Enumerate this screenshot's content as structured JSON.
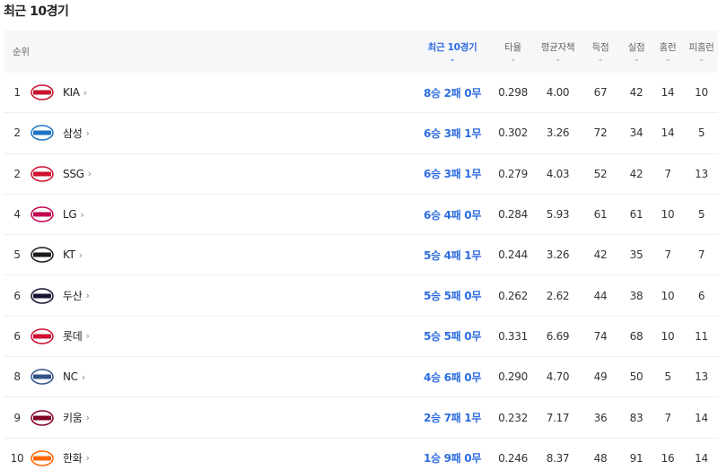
{
  "page": {
    "title": "최근 10경기"
  },
  "headers": {
    "rank": "순위",
    "recent": "최근 10경기",
    "avg": "타율",
    "era": "평균자책",
    "runs": "득점",
    "allowed": "실점",
    "hr": "홈런",
    "hra": "피홈런",
    "sort_icon": "chevron-down-icon"
  },
  "rows": [
    {
      "rank": "1",
      "team": "KIA",
      "recent": "8승 2패 0무",
      "avg": "0.298",
      "era": "4.00",
      "runs": "67",
      "allowed": "42",
      "hr": "14",
      "hra": "10",
      "logo_color": "#c8102e",
      "logo_text": "TIGERS"
    },
    {
      "rank": "2",
      "team": "삼성",
      "recent": "6승 3패 1무",
      "avg": "0.302",
      "era": "3.26",
      "runs": "72",
      "allowed": "34",
      "hr": "14",
      "hra": "5",
      "logo_color": "#1e74c6",
      "logo_text": "Lions"
    },
    {
      "rank": "2",
      "team": "SSG",
      "recent": "6승 3패 1무",
      "avg": "0.279",
      "era": "4.03",
      "runs": "52",
      "allowed": "42",
      "hr": "7",
      "hra": "13",
      "logo_color": "#ce0e2d",
      "logo_text": "Landers"
    },
    {
      "rank": "4",
      "team": "LG",
      "recent": "6승 4패 0무",
      "avg": "0.284",
      "era": "5.93",
      "runs": "61",
      "allowed": "61",
      "hr": "10",
      "hra": "5",
      "logo_color": "#c30452",
      "logo_text": "TWINS"
    },
    {
      "rank": "5",
      "team": "KT",
      "recent": "5승 4패 1무",
      "avg": "0.244",
      "era": "3.26",
      "runs": "42",
      "allowed": "35",
      "hr": "7",
      "hra": "7",
      "logo_color": "#1a1a1a",
      "logo_text": "kt wiz"
    },
    {
      "rank": "6",
      "team": "두산",
      "recent": "5승 5패 0무",
      "avg": "0.262",
      "era": "2.62",
      "runs": "44",
      "allowed": "38",
      "hr": "10",
      "hra": "6",
      "logo_color": "#131230",
      "logo_text": "Bears"
    },
    {
      "rank": "6",
      "team": "롯데",
      "recent": "5승 5패 0무",
      "avg": "0.331",
      "era": "6.69",
      "runs": "74",
      "allowed": "68",
      "hr": "10",
      "hra": "11",
      "logo_color": "#d00f31",
      "logo_text": "Giants"
    },
    {
      "rank": "8",
      "team": "NC",
      "recent": "4승 6패 0무",
      "avg": "0.290",
      "era": "4.70",
      "runs": "49",
      "allowed": "50",
      "hr": "5",
      "hra": "13",
      "logo_color": "#315288",
      "logo_text": "Dinos"
    },
    {
      "rank": "9",
      "team": "키움",
      "recent": "2승 7패 1무",
      "avg": "0.232",
      "era": "7.17",
      "runs": "36",
      "allowed": "83",
      "hr": "7",
      "hra": "14",
      "logo_color": "#820024",
      "logo_text": "Heroes"
    },
    {
      "rank": "10",
      "team": "한화",
      "recent": "1승 9패 0무",
      "avg": "0.246",
      "era": "8.37",
      "runs": "48",
      "allowed": "91",
      "hr": "16",
      "hra": "14",
      "logo_color": "#ff6600",
      "logo_text": "Eagles"
    }
  ]
}
